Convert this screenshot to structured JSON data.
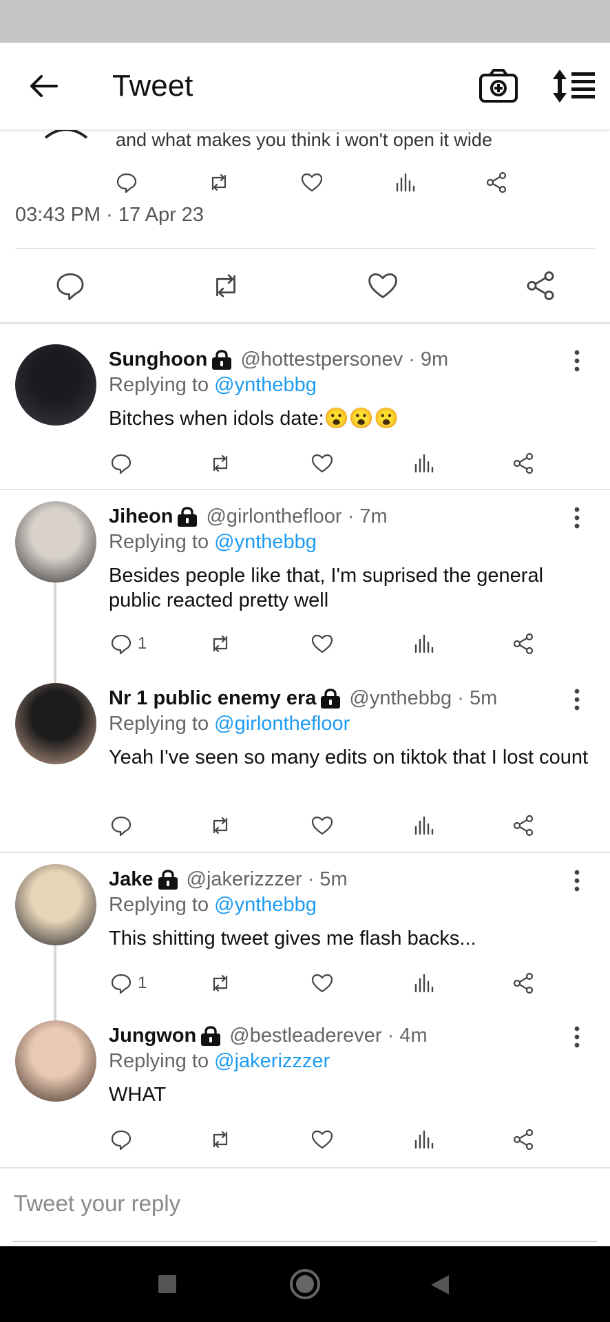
{
  "header": {
    "title": "Tweet"
  },
  "prev_tweet": {
    "text": "and what makes you think i won't open it wide"
  },
  "main_tweet": {
    "timestamp": "03:43 PM · 17 Apr 23"
  },
  "replies": [
    {
      "name": "Sunghoon",
      "handle": "@hottestpersonev · 9m",
      "replying_prefix": "Replying to ",
      "replying_to": "@ynthebbg",
      "text": "Bitches when idols date:😮😮😮",
      "reply_count": "",
      "avatar_colors": [
        "#1a1a1f",
        "#3a3a42"
      ]
    },
    {
      "name": "Jiheon",
      "handle": "@girlonthefloor · 7m",
      "replying_prefix": "Replying to ",
      "replying_to": "@ynthebbg",
      "text": "Besides people like that, I'm suprised the general public reacted pretty well",
      "reply_count": "1",
      "avatar_colors": [
        "#d9d2cc",
        "#2b2b2b"
      ]
    },
    {
      "name": "Nr 1 public enemy era",
      "handle": "@ynthebbg · 5m",
      "replying_prefix": "Replying to ",
      "replying_to": "@girlonthefloor",
      "text": "Yeah I've seen so many edits on tiktok that I lost count",
      "reply_count": "",
      "avatar_colors": [
        "#1c1c1c",
        "#c9a38f"
      ]
    },
    {
      "name": "Jake",
      "handle": "@jakerizzzer · 5m",
      "replying_prefix": "Replying to ",
      "replying_to": "@ynthebbg",
      "text": "This shitting tweet gives me flash backs...",
      "reply_count": "1",
      "avatar_colors": [
        "#e8d6b8",
        "#1e1e28"
      ]
    },
    {
      "name": "Jungwon",
      "handle": "@bestleaderever · 4m",
      "replying_prefix": "Replying to ",
      "replying_to": "@jakerizzzer",
      "text": "WHAT",
      "reply_count": "",
      "avatar_colors": [
        "#e9c9b3",
        "#3a2a22"
      ]
    }
  ],
  "compose": {
    "placeholder": "Tweet your reply"
  },
  "colors": {
    "link": "#1d9bf0",
    "icon": "#444444",
    "muted": "#666666"
  }
}
